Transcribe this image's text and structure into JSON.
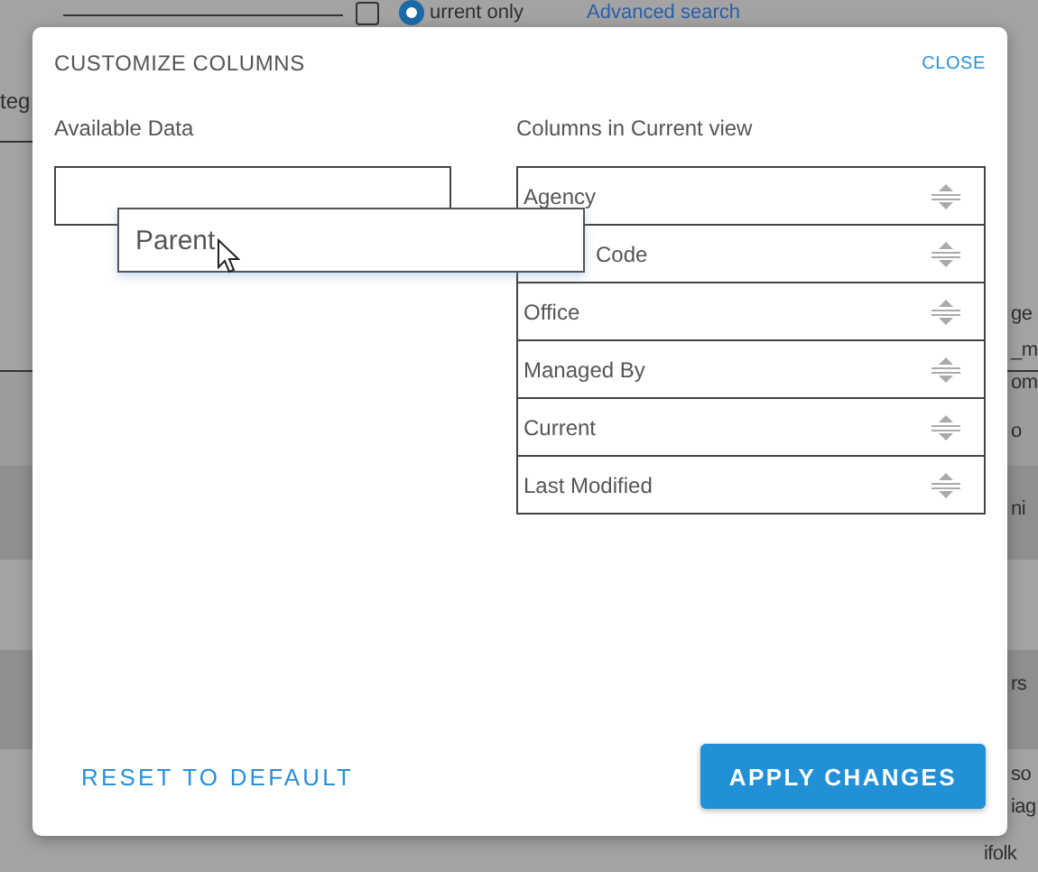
{
  "background": {
    "current_only": {
      "checked": false,
      "selected": true,
      "label": "urrent only"
    },
    "link": "Advanced search",
    "left_fragments": [
      "teg"
    ],
    "right_fragments": [
      "ge",
      "_m",
      "om",
      "o",
      "ni",
      "rs",
      "so",
      "iag",
      "ifolk"
    ]
  },
  "dialog": {
    "title": "CUSTOMIZE COLUMNS",
    "close": "CLOSE",
    "available": {
      "heading": "Available Data",
      "dragged_item": "Parent"
    },
    "current": {
      "heading": "Columns in Current view",
      "items": [
        {
          "label": "Agency",
          "kind": "plain"
        },
        {
          "label": "Code",
          "kind": "covered"
        },
        {
          "label": "Office",
          "kind": "plain"
        },
        {
          "label": "Managed By",
          "kind": "plain"
        },
        {
          "label": "Current",
          "kind": "plain"
        },
        {
          "label": "Last Modified",
          "kind": "plain"
        }
      ]
    },
    "buttons": {
      "reset": "RESET TO DEFAULT",
      "apply": "APPLY CHANGES"
    }
  }
}
